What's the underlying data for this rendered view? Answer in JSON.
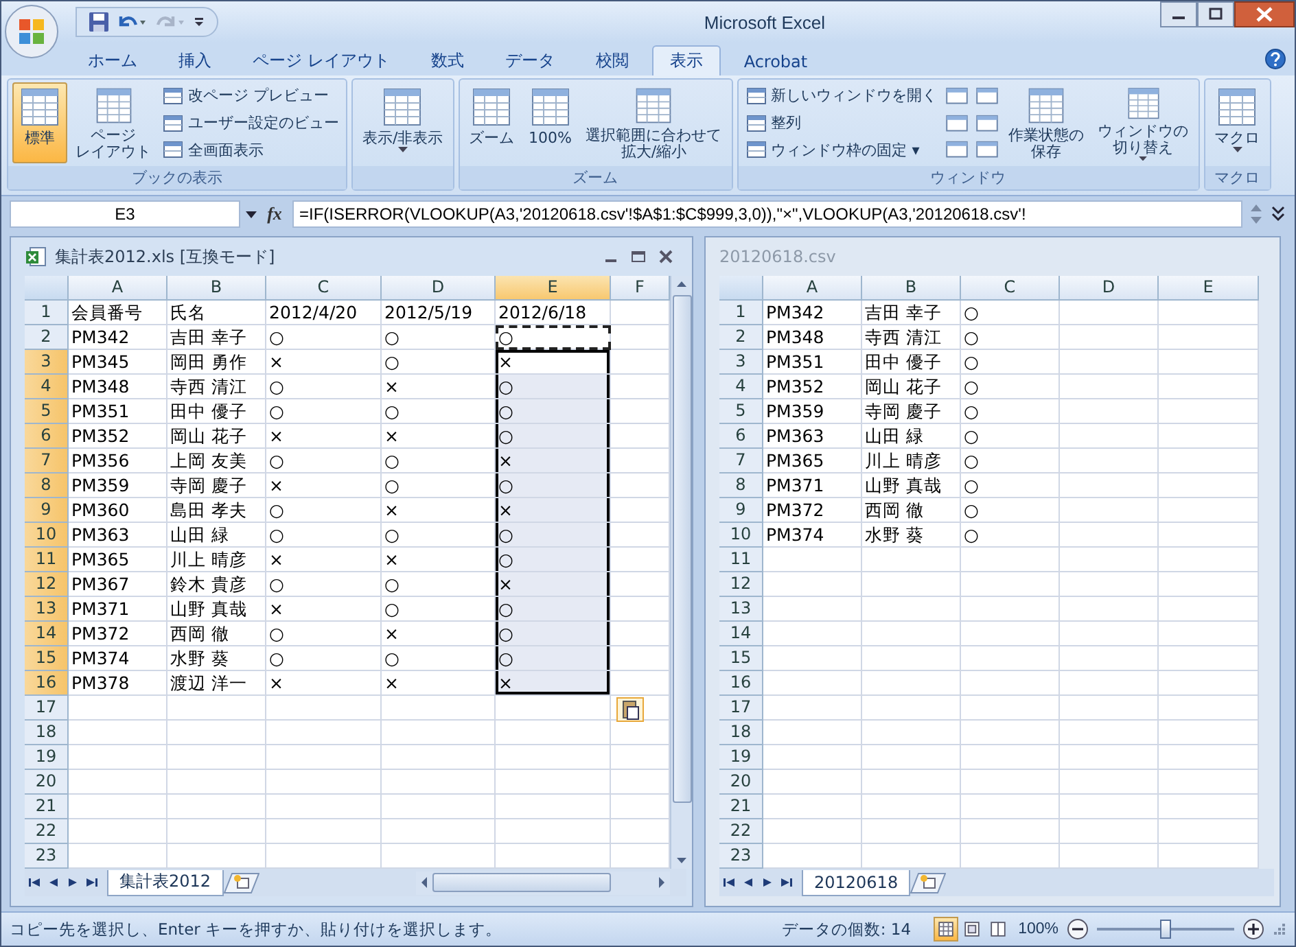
{
  "window": {
    "title": "Microsoft Excel"
  },
  "tabs": [
    {
      "label": "ホーム",
      "selected": false
    },
    {
      "label": "挿入",
      "selected": false
    },
    {
      "label": "ページ レイアウト",
      "selected": false
    },
    {
      "label": "数式",
      "selected": false
    },
    {
      "label": "データ",
      "selected": false
    },
    {
      "label": "校閲",
      "selected": false
    },
    {
      "label": "表示",
      "selected": true
    },
    {
      "label": "Acrobat",
      "selected": false
    }
  ],
  "ribbon": {
    "groups": [
      {
        "label": "ブックの表示",
        "items": [
          {
            "kind": "large",
            "lines": [
              "標準"
            ],
            "selected": true,
            "menu": false
          },
          {
            "kind": "large",
            "lines": [
              "ページ",
              "レイアウト"
            ],
            "selected": false,
            "menu": false
          },
          {
            "kind": "small",
            "label": "改ページ プレビュー"
          },
          {
            "kind": "small",
            "label": "ユーザー設定のビュー"
          },
          {
            "kind": "small",
            "label": "全画面表示"
          }
        ]
      },
      {
        "items": [
          {
            "kind": "large",
            "lines": [
              "表示/非表示"
            ],
            "selected": false,
            "menu": true
          }
        ]
      },
      {
        "label": "ズーム",
        "items": [
          {
            "kind": "large",
            "lines": [
              "ズーム"
            ],
            "selected": false,
            "menu": false
          },
          {
            "kind": "large",
            "lines": [
              "100%"
            ],
            "selected": false,
            "menu": false
          },
          {
            "kind": "large",
            "lines": [
              "選択範囲に合わせて",
              "拡大/縮小"
            ],
            "selected": false,
            "menu": false
          }
        ]
      },
      {
        "label": "ウィンドウ",
        "items": [
          {
            "kind": "small",
            "label": "新しいウィンドウを開く"
          },
          {
            "kind": "small",
            "label": "整列"
          },
          {
            "kind": "small",
            "label": "ウィンドウ枠の固定 ▾"
          },
          {
            "kind": "icon"
          },
          {
            "kind": "icon"
          },
          {
            "kind": "icon"
          },
          {
            "kind": "icon"
          },
          {
            "kind": "icon"
          },
          {
            "kind": "icon"
          },
          {
            "kind": "large",
            "lines": [
              "作業状態の",
              "保存"
            ],
            "selected": false,
            "menu": false
          },
          {
            "kind": "large",
            "lines": [
              "ウィンドウの",
              "切り替え"
            ],
            "selected": false,
            "menu": true
          }
        ]
      },
      {
        "label": "マクロ",
        "items": [
          {
            "kind": "large",
            "lines": [
              "マクロ"
            ],
            "selected": false,
            "menu": true
          }
        ]
      }
    ]
  },
  "formula_bar": {
    "name_box": "E3",
    "function_label": "fx",
    "formula": "=IF(ISERROR(VLOOKUP(A3,'20120618.csv'!$A$1:$C$999,3,0)),\"×\",VLOOKUP(A3,'20120618.csv'!"
  },
  "workbooks": [
    {
      "title": "集計表2012.xls [互換モード]",
      "active": true,
      "paste_options_shown": true,
      "columns": [
        {
          "label": "A",
          "selected": false
        },
        {
          "label": "B",
          "selected": false
        },
        {
          "label": "C",
          "selected": false
        },
        {
          "label": "D",
          "selected": false
        },
        {
          "label": "E",
          "selected": true
        },
        {
          "label": "F",
          "selected": false
        }
      ],
      "rows": [
        {
          "number": "1",
          "selected": false,
          "copied": false,
          "cells": [
            "会員番号",
            "氏名",
            "2012/4/20",
            "2012/5/19",
            "2012/6/18"
          ]
        },
        {
          "number": "2",
          "selected": false,
          "copied": true,
          "cells": [
            "PM342",
            "吉田 幸子",
            "○",
            "○",
            "○"
          ]
        },
        {
          "number": "3",
          "selected": true,
          "copied": false,
          "cells": [
            "PM345",
            "岡田 勇作",
            "×",
            "○",
            "×"
          ]
        },
        {
          "number": "4",
          "selected": true,
          "copied": false,
          "cells": [
            "PM348",
            "寺西 清江",
            "○",
            "×",
            "○"
          ]
        },
        {
          "number": "5",
          "selected": true,
          "copied": false,
          "cells": [
            "PM351",
            "田中 優子",
            "○",
            "○",
            "○"
          ]
        },
        {
          "number": "6",
          "selected": true,
          "copied": false,
          "cells": [
            "PM352",
            "岡山 花子",
            "×",
            "×",
            "○"
          ]
        },
        {
          "number": "7",
          "selected": true,
          "copied": false,
          "cells": [
            "PM356",
            "上岡 友美",
            "○",
            "○",
            "×"
          ]
        },
        {
          "number": "8",
          "selected": true,
          "copied": false,
          "cells": [
            "PM359",
            "寺岡 慶子",
            "×",
            "○",
            "○"
          ]
        },
        {
          "number": "9",
          "selected": true,
          "copied": false,
          "cells": [
            "PM360",
            "島田 孝夫",
            "○",
            "×",
            "×"
          ]
        },
        {
          "number": "10",
          "selected": true,
          "copied": false,
          "cells": [
            "PM363",
            "山田 緑",
            "○",
            "○",
            "○"
          ]
        },
        {
          "number": "11",
          "selected": true,
          "copied": false,
          "cells": [
            "PM365",
            "川上 晴彦",
            "×",
            "×",
            "○"
          ]
        },
        {
          "number": "12",
          "selected": true,
          "copied": false,
          "cells": [
            "PM367",
            "鈴木 貴彦",
            "○",
            "○",
            "×"
          ]
        },
        {
          "number": "13",
          "selected": true,
          "copied": false,
          "cells": [
            "PM371",
            "山野 真哉",
            "×",
            "○",
            "○"
          ]
        },
        {
          "number": "14",
          "selected": true,
          "copied": false,
          "cells": [
            "PM372",
            "西岡 徹",
            "○",
            "×",
            "○"
          ]
        },
        {
          "number": "15",
          "selected": true,
          "copied": false,
          "cells": [
            "PM374",
            "水野 葵",
            "○",
            "○",
            "○"
          ]
        },
        {
          "number": "16",
          "selected": true,
          "copied": false,
          "cells": [
            "PM378",
            "渡辺 洋一",
            "×",
            "×",
            "×"
          ]
        },
        {
          "number": "17",
          "selected": false,
          "copied": false,
          "cells": []
        },
        {
          "number": "18",
          "selected": false,
          "copied": false,
          "cells": []
        },
        {
          "number": "19",
          "selected": false,
          "copied": false,
          "cells": []
        },
        {
          "number": "20",
          "selected": false,
          "copied": false,
          "cells": []
        },
        {
          "number": "21",
          "selected": false,
          "copied": false,
          "cells": []
        },
        {
          "number": "22",
          "selected": false,
          "copied": false,
          "cells": []
        },
        {
          "number": "23",
          "selected": false,
          "copied": false,
          "cells": []
        }
      ],
      "sheet_tabs": [
        {
          "label": "集計表2012"
        }
      ]
    },
    {
      "title": "20120618.csv",
      "active": false,
      "columns": [
        {
          "label": "A",
          "selected": false
        },
        {
          "label": "B",
          "selected": false
        },
        {
          "label": "C",
          "selected": false
        },
        {
          "label": "D",
          "selected": false
        },
        {
          "label": "E",
          "selected": false
        }
      ],
      "rows": [
        {
          "number": "1",
          "selected": false,
          "cells": [
            "PM342",
            "吉田 幸子",
            "○"
          ]
        },
        {
          "number": "2",
          "selected": false,
          "cells": [
            "PM348",
            "寺西 清江",
            "○"
          ]
        },
        {
          "number": "3",
          "selected": false,
          "cells": [
            "PM351",
            "田中 優子",
            "○"
          ]
        },
        {
          "number": "4",
          "selected": false,
          "cells": [
            "PM352",
            "岡山 花子",
            "○"
          ]
        },
        {
          "number": "5",
          "selected": false,
          "cells": [
            "PM359",
            "寺岡 慶子",
            "○"
          ]
        },
        {
          "number": "6",
          "selected": false,
          "cells": [
            "PM363",
            "山田 緑",
            "○"
          ]
        },
        {
          "number": "7",
          "selected": false,
          "cells": [
            "PM365",
            "川上 晴彦",
            "○"
          ]
        },
        {
          "number": "8",
          "selected": false,
          "cells": [
            "PM371",
            "山野 真哉",
            "○"
          ]
        },
        {
          "number": "9",
          "selected": false,
          "cells": [
            "PM372",
            "西岡 徹",
            "○"
          ]
        },
        {
          "number": "10",
          "selected": false,
          "cells": [
            "PM374",
            "水野 葵",
            "○"
          ]
        },
        {
          "number": "11",
          "selected": false,
          "cells": []
        },
        {
          "number": "12",
          "selected": false,
          "cells": []
        },
        {
          "number": "13",
          "selected": false,
          "cells": []
        },
        {
          "number": "14",
          "selected": false,
          "cells": []
        },
        {
          "number": "15",
          "selected": false,
          "cells": []
        },
        {
          "number": "16",
          "selected": false,
          "cells": []
        },
        {
          "number": "17",
          "selected": false,
          "cells": []
        },
        {
          "number": "18",
          "selected": false,
          "cells": []
        },
        {
          "number": "19",
          "selected": false,
          "cells": []
        },
        {
          "number": "20",
          "selected": false,
          "cells": []
        },
        {
          "number": "21",
          "selected": false,
          "cells": []
        },
        {
          "number": "22",
          "selected": false,
          "cells": []
        },
        {
          "number": "23",
          "selected": false,
          "cells": []
        }
      ],
      "sheet_tabs": [
        {
          "label": "20120618"
        }
      ]
    }
  ],
  "status_bar": {
    "message": "コピー先を選択し、Enter キーを押すか、貼り付けを選択します。",
    "count": "データの個数: 14",
    "views": [
      {
        "selected": true
      },
      {
        "selected": false
      },
      {
        "selected": false
      }
    ],
    "zoom": "100%",
    "zoom_slider": {
      "level": 0.5
    }
  }
}
